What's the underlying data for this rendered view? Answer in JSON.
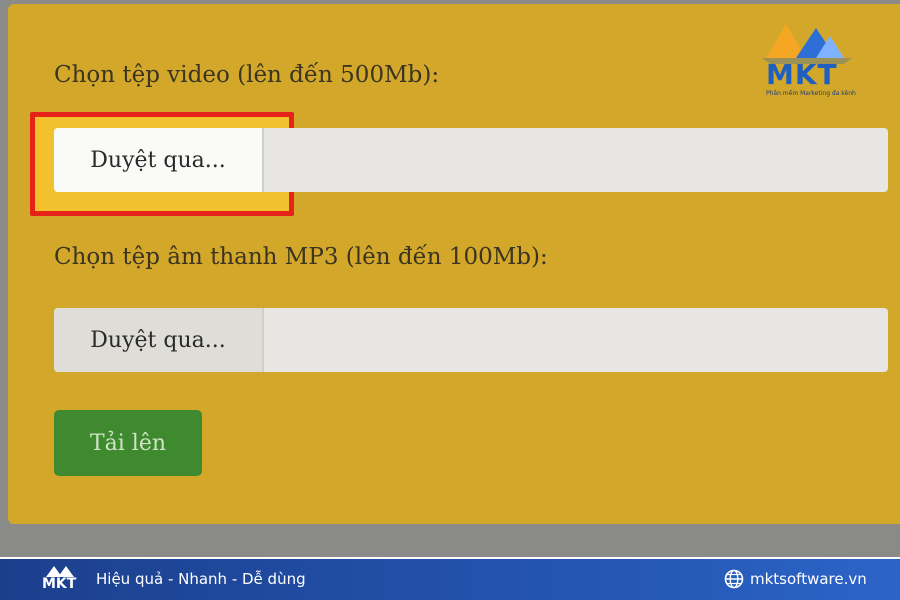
{
  "form": {
    "video_label": "Chọn tệp video (lên đến 500Mb):",
    "video_browse_label": "Duyệt qua...",
    "audio_label": "Chọn tệp âm thanh MP3 (lên đến 100Mb):",
    "audio_browse_label": "Duyệt qua...",
    "upload_label": "Tải lên"
  },
  "branding": {
    "logo_text": "MKT",
    "logo_tagline": "Phần mềm Marketing đa kênh",
    "footer_logo_text": "MKT",
    "slogan": "Hiệu quả - Nhanh - Dễ dùng",
    "website": "mktsoftware.vn"
  },
  "colors": {
    "panel": "#d3a82a",
    "highlight_border": "#e5231a",
    "upload_button": "#3f8a2e",
    "footer": "#2354b0"
  },
  "icons": {
    "logo": "mkt-logo-icon",
    "footer_logo": "mkt-logo-icon",
    "website": "globe-icon"
  }
}
